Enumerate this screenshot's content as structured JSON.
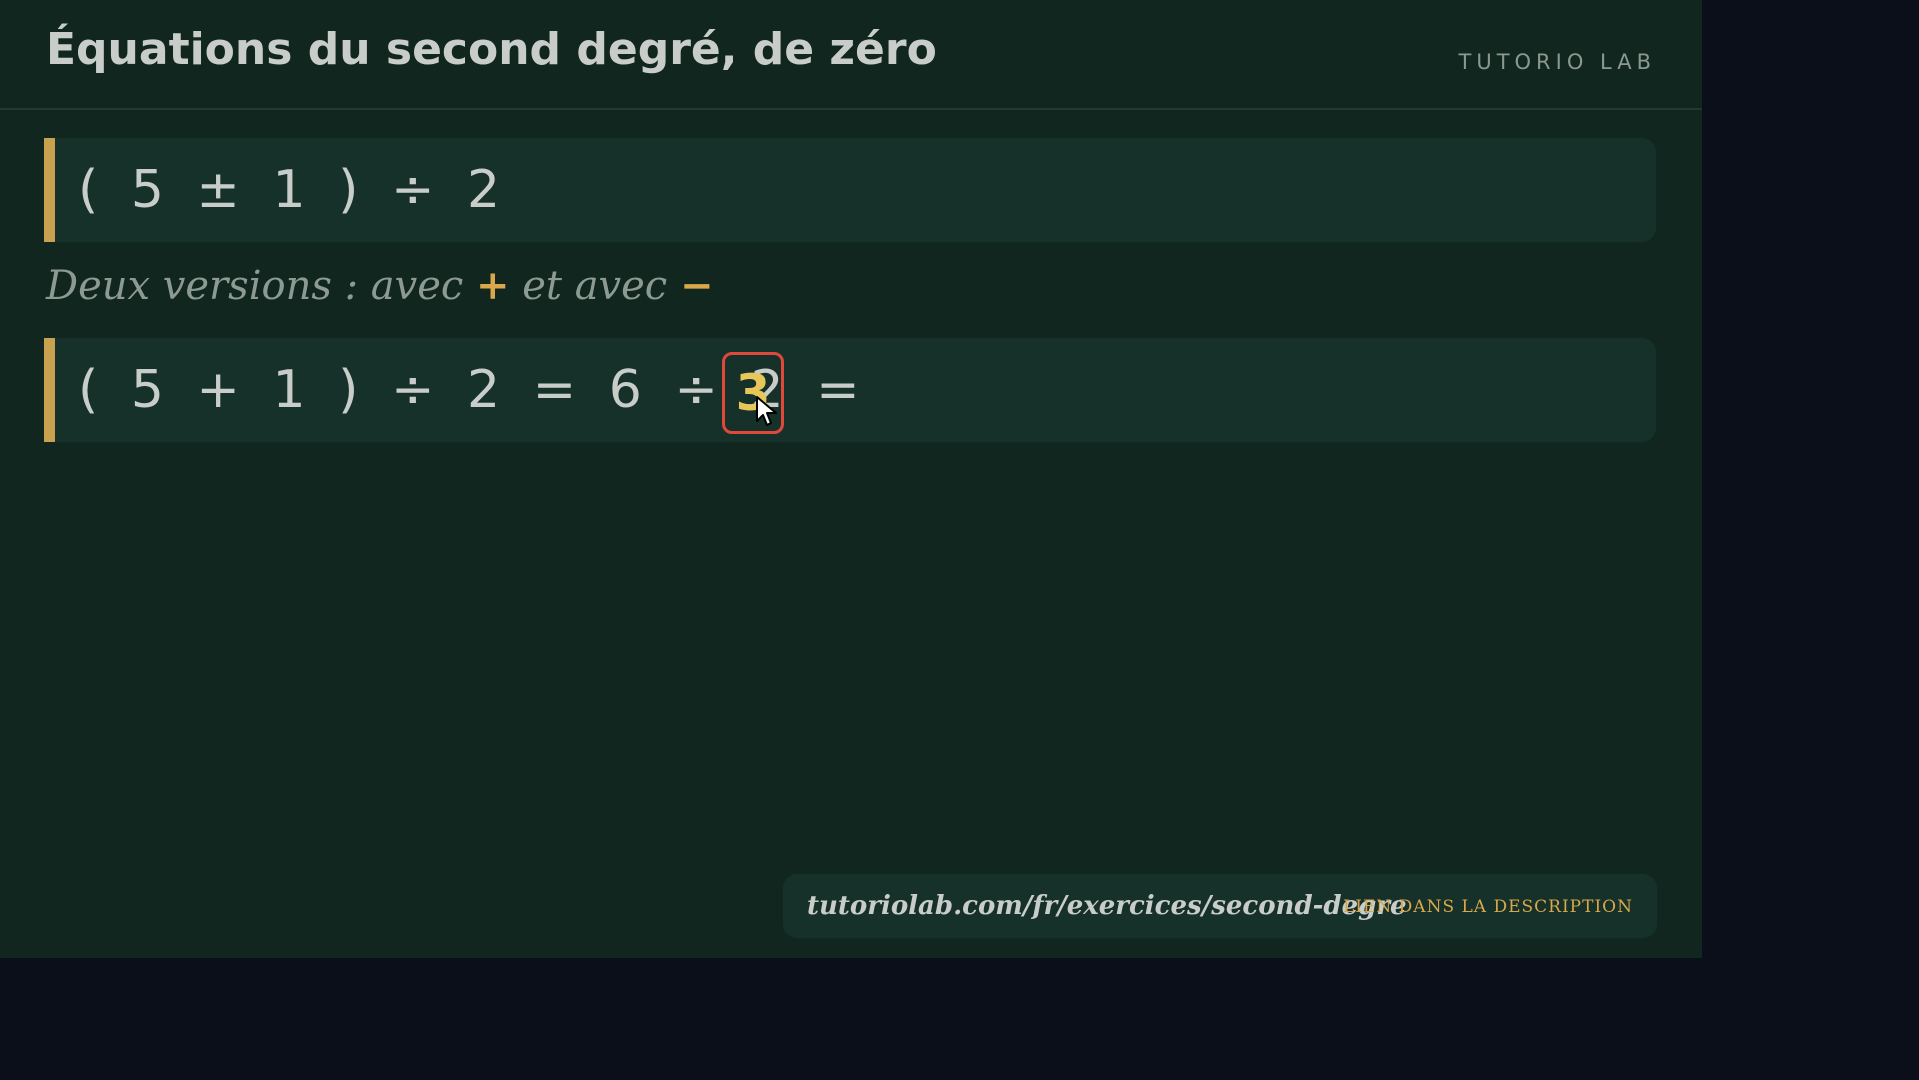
{
  "header": {
    "title": "Équations du second degré, de zéro",
    "brand": "TUTORIO LAB"
  },
  "equation_1": "( 5 ± 1 ) ÷ 2",
  "subtitle": {
    "part1": "Deux versions : avec ",
    "plus": "+",
    "part2": " et avec ",
    "minus": "−"
  },
  "equation_2": {
    "expression": "( 5 + 1 ) ÷ 2 = 6 ÷ 2 =",
    "answer": "3"
  },
  "footer": {
    "url": "tutoriolab.com/fr/exercices/second-degre",
    "description": "LIEN DANS LA DESCRIPTION"
  },
  "colors": {
    "board": "#10261f",
    "accent": "#c8a24f",
    "highlight": "#e0483b",
    "answer": "#e8c75a"
  }
}
